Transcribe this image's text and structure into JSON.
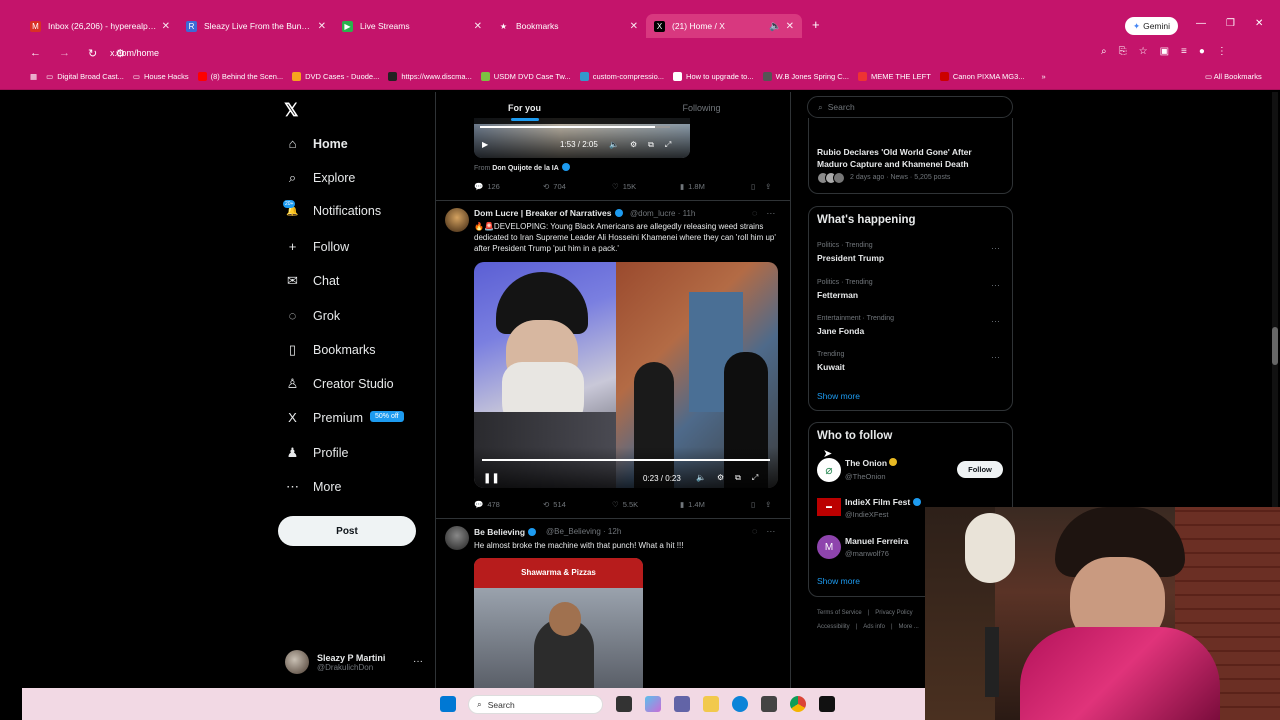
{
  "browser": {
    "tabs": [
      {
        "label": "Inbox (26,206) - hyperealprod",
        "color": "#d93025",
        "icon": "M"
      },
      {
        "label": "Sleazy Live From the Bunker 2/",
        "color": "#3b6bd6",
        "icon": "R"
      },
      {
        "label": "Live Streams",
        "color": "#2bb24c",
        "icon": "▶"
      },
      {
        "label": "Bookmarks",
        "color": "#c4146b",
        "icon": "★"
      },
      {
        "label": "(21) Home / X",
        "color": "#000000",
        "icon": "X"
      }
    ],
    "new_tab": "+",
    "gemini_label": "Gemini",
    "url": "x.com/home",
    "bookmarks": [
      "Digital Broad Cast...",
      "House Hacks",
      "(8) Behind the Scen...",
      "DVD Cases - Duode...",
      "https://www.discma...",
      "USDM DVD Case Tw...",
      "custom-compressio...",
      "How to upgrade to...",
      "W.B Jones Spring C...",
      "MEME THE LEFT",
      "Canon PIXMA MG3..."
    ],
    "all_bookmarks": "All Bookmarks"
  },
  "nav": {
    "items": [
      {
        "label": "Home",
        "icon": "⌂"
      },
      {
        "label": "Explore",
        "icon": "⌕"
      },
      {
        "label": "Notifications",
        "icon": "🔔"
      },
      {
        "label": "Follow",
        "icon": "+"
      },
      {
        "label": "Chat",
        "icon": "✉"
      },
      {
        "label": "Grok",
        "icon": "◌"
      },
      {
        "label": "Bookmarks",
        "icon": "▯"
      },
      {
        "label": "Creator Studio",
        "icon": "♙"
      },
      {
        "label": "Premium",
        "icon": "X"
      },
      {
        "label": "Profile",
        "icon": "♟"
      },
      {
        "label": "More",
        "icon": "⋯"
      }
    ],
    "notif_badge": "20+",
    "premium_pill": "50% off",
    "post_label": "Post",
    "account_name": "Sleazy P Martini",
    "account_handle": "@DrakulichDon",
    "account_more": "···"
  },
  "timeline": {
    "tab_foryou": "For you",
    "tab_following": "Following",
    "tweet0": {
      "video_time": "1:53 / 2:05",
      "from_prefix": "From",
      "from_name": "Don Quijote de la IA",
      "replies": "126",
      "reposts": "704",
      "likes": "15K",
      "views": "1.8M"
    },
    "tweet1": {
      "name": "Dom Lucre | Breaker of Narratives",
      "handle": "@dom_lucre · 11h",
      "text": "🔥🚨DEVELOPING: Young Black Americans are allegedly releasing weed strains dedicated to Iran Supreme Leader Ali Hosseini Khamenei where they can 'roll him up' after President Trump 'put him in a pack.'",
      "video_time": "0:23 / 0:23",
      "replies": "478",
      "reposts": "514",
      "likes": "5.5K",
      "views": "1.4M"
    },
    "tweet2": {
      "name": "Be Believing",
      "handle": "@Be_Believing · 12h",
      "text": "He almost broke the machine with that punch! What a hit !!!",
      "sign_text": "Shawarma & Pizzas"
    }
  },
  "sidebar": {
    "search_placeholder": "Search",
    "news_title": "Rubio Declares 'Old World Gone' After Maduro Capture and Khamenei Death",
    "news_meta": "2 days ago · News · 5,205 posts",
    "whats_happening": "What's happening",
    "trends": [
      {
        "meta": "Politics · Trending",
        "title": "President Trump"
      },
      {
        "meta": "Politics · Trending",
        "title": "Fetterman"
      },
      {
        "meta": "Entertainment · Trending",
        "title": "Jane Fonda"
      },
      {
        "meta": "Trending",
        "title": "Kuwait"
      }
    ],
    "show_more": "Show more",
    "who_to_follow": "Who to follow",
    "follows": [
      {
        "name": "The Onion",
        "handle": "@TheOnion"
      },
      {
        "name": "IndieX Film Fest",
        "handle": "@IndieXFest"
      },
      {
        "name": "Manuel Ferreira",
        "handle": "@manwolf76"
      }
    ],
    "follow_label": "Follow",
    "show_more2": "Show more",
    "footer": [
      "Terms of Service",
      "|",
      "Privacy Policy",
      "Accessibility",
      "|",
      "Ads info",
      "|",
      "More ..."
    ]
  },
  "taskbar": {
    "search_label": "Search"
  }
}
